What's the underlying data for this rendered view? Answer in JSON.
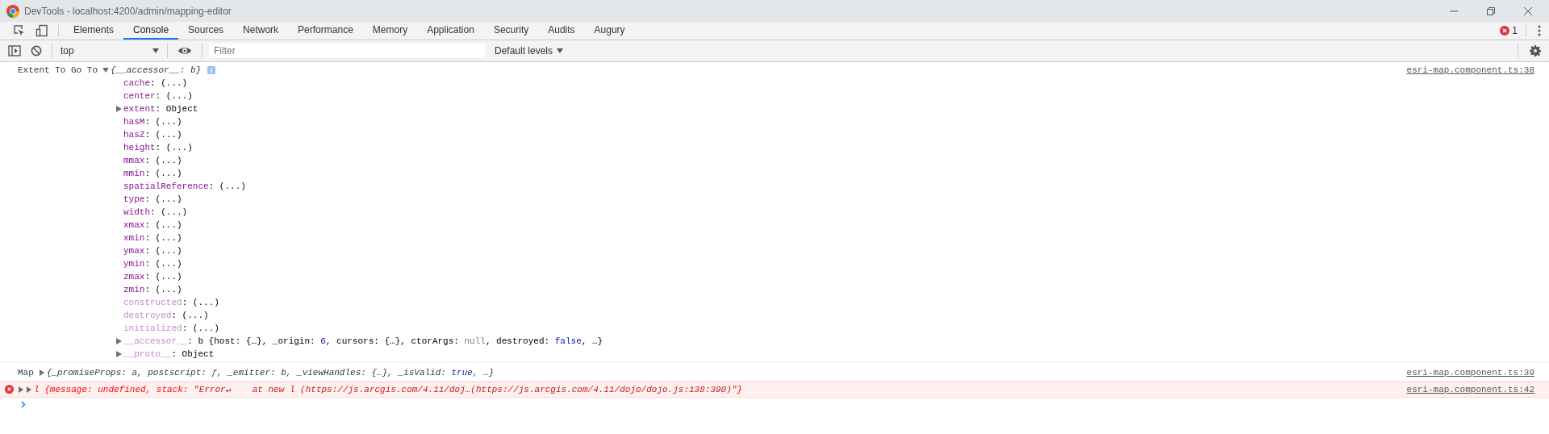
{
  "window": {
    "title": "DevTools - localhost:4200/admin/mapping-editor"
  },
  "tabs": [
    {
      "label": "Elements",
      "selected": false
    },
    {
      "label": "Console",
      "selected": true
    },
    {
      "label": "Sources",
      "selected": false
    },
    {
      "label": "Network",
      "selected": false
    },
    {
      "label": "Performance",
      "selected": false
    },
    {
      "label": "Memory",
      "selected": false
    },
    {
      "label": "Application",
      "selected": false
    },
    {
      "label": "Security",
      "selected": false
    },
    {
      "label": "Audits",
      "selected": false
    },
    {
      "label": "Augury",
      "selected": false
    }
  ],
  "error_count": "1",
  "toolbar": {
    "context": "top",
    "filter_placeholder": "Filter",
    "levels": "Default levels"
  },
  "messages": [
    {
      "kind": "log",
      "label": "Extent To Go To",
      "expanded": true,
      "source": "esri-map.component.ts:38",
      "preview": [
        {
          "text": "{__accessor__: b}",
          "kind": "plain"
        }
      ],
      "properties": [
        {
          "name": "cache",
          "kind": "getter",
          "faded": false,
          "value": [
            {
              "text": ": (...)",
              "kind": "plain"
            }
          ]
        },
        {
          "name": "center",
          "kind": "getter",
          "faded": false,
          "value": [
            {
              "text": ": (...)",
              "kind": "plain"
            }
          ]
        },
        {
          "name": "extent",
          "kind": "object",
          "faded": false,
          "value": [
            {
              "text": ": Object",
              "kind": "plain"
            }
          ]
        },
        {
          "name": "hasM",
          "kind": "getter",
          "faded": false,
          "value": [
            {
              "text": ": (...)",
              "kind": "plain"
            }
          ]
        },
        {
          "name": "hasZ",
          "kind": "getter",
          "faded": false,
          "value": [
            {
              "text": ": (...)",
              "kind": "plain"
            }
          ]
        },
        {
          "name": "height",
          "kind": "getter",
          "faded": false,
          "value": [
            {
              "text": ": (...)",
              "kind": "plain"
            }
          ]
        },
        {
          "name": "mmax",
          "kind": "getter",
          "faded": false,
          "value": [
            {
              "text": ": (...)",
              "kind": "plain"
            }
          ]
        },
        {
          "name": "mmin",
          "kind": "getter",
          "faded": false,
          "value": [
            {
              "text": ": (...)",
              "kind": "plain"
            }
          ]
        },
        {
          "name": "spatialReference",
          "kind": "getter",
          "faded": false,
          "value": [
            {
              "text": ": (...)",
              "kind": "plain"
            }
          ]
        },
        {
          "name": "type",
          "kind": "getter",
          "faded": false,
          "value": [
            {
              "text": ": (...)",
              "kind": "plain"
            }
          ]
        },
        {
          "name": "width",
          "kind": "getter",
          "faded": false,
          "value": [
            {
              "text": ": (...)",
              "kind": "plain"
            }
          ]
        },
        {
          "name": "xmax",
          "kind": "getter",
          "faded": false,
          "value": [
            {
              "text": ": (...)",
              "kind": "plain"
            }
          ]
        },
        {
          "name": "xmin",
          "kind": "getter",
          "faded": false,
          "value": [
            {
              "text": ": (...)",
              "kind": "plain"
            }
          ]
        },
        {
          "name": "ymax",
          "kind": "getter",
          "faded": false,
          "value": [
            {
              "text": ": (...)",
              "kind": "plain"
            }
          ]
        },
        {
          "name": "ymin",
          "kind": "getter",
          "faded": false,
          "value": [
            {
              "text": ": (...)",
              "kind": "plain"
            }
          ]
        },
        {
          "name": "zmax",
          "kind": "getter",
          "faded": false,
          "value": [
            {
              "text": ": (...)",
              "kind": "plain"
            }
          ]
        },
        {
          "name": "zmin",
          "kind": "getter",
          "faded": false,
          "value": [
            {
              "text": ": (...)",
              "kind": "plain"
            }
          ]
        },
        {
          "name": "constructed",
          "kind": "getter",
          "faded": true,
          "value": [
            {
              "text": ": (...)",
              "kind": "plain"
            }
          ]
        },
        {
          "name": "destroyed",
          "kind": "getter",
          "faded": true,
          "value": [
            {
              "text": ": (...)",
              "kind": "plain"
            }
          ]
        },
        {
          "name": "initialized",
          "kind": "getter",
          "faded": true,
          "value": [
            {
              "text": ": (...)",
              "kind": "plain"
            }
          ]
        },
        {
          "name": "__accessor__",
          "kind": "object",
          "faded": true,
          "value": [
            {
              "text": ": b {host: {…}, _origin: ",
              "kind": "plain"
            },
            {
              "text": "6",
              "kind": "num"
            },
            {
              "text": ", cursors: {…}, ctorArgs: ",
              "kind": "plain"
            },
            {
              "text": "null",
              "kind": "null"
            },
            {
              "text": ", destroyed: ",
              "kind": "plain"
            },
            {
              "text": "false",
              "kind": "kw"
            },
            {
              "text": ", …}",
              "kind": "plain"
            }
          ]
        },
        {
          "name": "__proto__",
          "kind": "object",
          "faded": true,
          "value": [
            {
              "text": ": Object",
              "kind": "plain"
            }
          ]
        }
      ]
    },
    {
      "kind": "log",
      "label": "Map",
      "expanded": false,
      "source": "esri-map.component.ts:39",
      "preview": [
        {
          "text": "{_promiseProps: a, postscript: ƒ, _emitter: b, _viewHandles: {…}, _isValid: ",
          "kind": "plain"
        },
        {
          "text": "true",
          "kind": "kw"
        },
        {
          "text": ", …}",
          "kind": "plain"
        }
      ]
    },
    {
      "kind": "error",
      "expanded": false,
      "source": "esri-map.component.ts:42",
      "preview": [
        {
          "text": "l {message: ",
          "kind": "plain"
        },
        {
          "text": "undefined",
          "kind": "null"
        },
        {
          "text": ", stack: ",
          "kind": "plain"
        },
        {
          "text": "\"Error↵    at new l (https://js.arcgis.com/4.11/doj…(https://js.arcgis.com/4.11/dojo/dojo.js:138:390)\"",
          "kind": "str"
        },
        {
          "text": "}",
          "kind": "plain"
        }
      ]
    }
  ]
}
